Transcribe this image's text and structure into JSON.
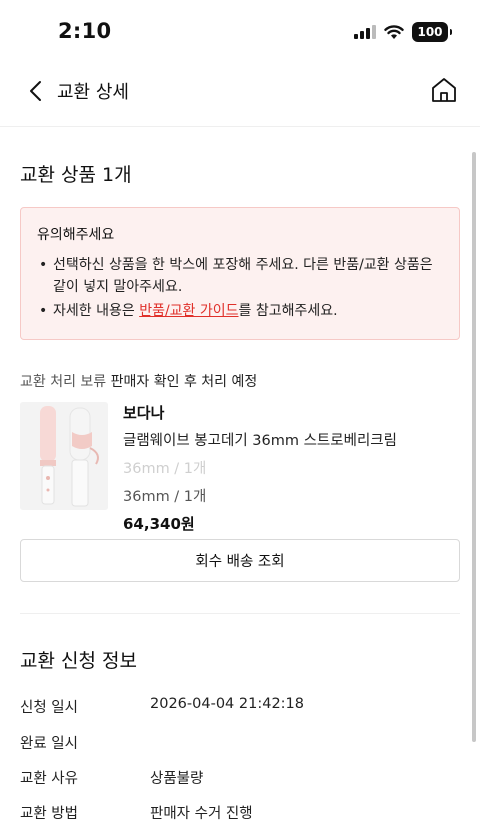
{
  "status_bar": {
    "time": "2:10",
    "battery": "100"
  },
  "header": {
    "title": "교환 상세"
  },
  "exchange_items": {
    "title": "교환 상품 1개",
    "notice": {
      "title": "유의해주세요",
      "item1": "선택하신 상품을 한 박스에 포장해 주세요. 다른 반품/교환 상품은 같이 넣지 말아주세요.",
      "item2_before": "자세한 내용은 ",
      "item2_link": "반품/교환 가이드",
      "item2_after": "를 참고해주세요."
    },
    "status_hold": "교환 처리 보류",
    "status_desc": " 판매자 확인 후 처리 예정",
    "product": {
      "brand": "보다나",
      "name": "글램웨이브 봉고데기 36mm 스트로베리크림",
      "option_original": "36mm / 1개",
      "option": "36mm / 1개",
      "price": "64,340원"
    },
    "track_button": "회수 배송 조회"
  },
  "request_info": {
    "title": "교환 신청 정보",
    "rows": [
      {
        "label": "신청 일시",
        "value": "2026-04-04 21:42:18"
      },
      {
        "label": "완료 일시",
        "value": ""
      },
      {
        "label": "교환 사유",
        "value": "상품불량"
      },
      {
        "label": "교환 방법",
        "value": "판매자 수거 진행"
      }
    ]
  },
  "icons": {
    "back": "chevron-left-icon",
    "home": "home-icon"
  }
}
